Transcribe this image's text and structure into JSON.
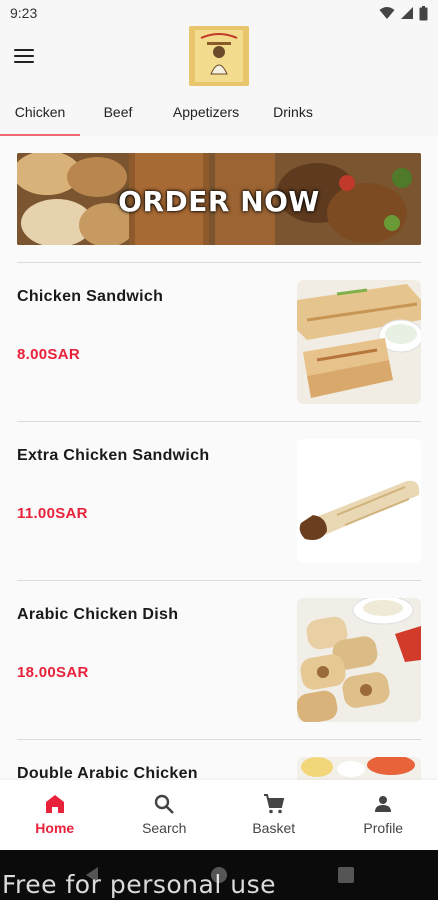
{
  "status_bar": {
    "time": "9:23"
  },
  "tabs": [
    {
      "label": "Chicken",
      "active": true
    },
    {
      "label": "Beef",
      "active": false
    },
    {
      "label": "Appetizers",
      "active": false
    },
    {
      "label": "Drinks",
      "active": false
    }
  ],
  "banner": {
    "text": "ORDER NOW"
  },
  "items": [
    {
      "name": "Chicken Sandwich",
      "price": "8.00SAR"
    },
    {
      "name": "Extra Chicken Sandwich",
      "price": "11.00SAR"
    },
    {
      "name": "Arabic  Chicken Dish",
      "price": "18.00SAR"
    },
    {
      "name": "Double Arabic Chicken",
      "price": ""
    }
  ],
  "bottom_nav": [
    {
      "label": "Home",
      "icon": "home-icon",
      "active": true
    },
    {
      "label": "Search",
      "icon": "search-icon",
      "active": false
    },
    {
      "label": "Basket",
      "icon": "cart-icon",
      "active": false
    },
    {
      "label": "Profile",
      "icon": "person-icon",
      "active": false
    }
  ],
  "watermark": "Free for personal use",
  "colors": {
    "accent": "#e8223a",
    "tab_indicator": "#f06a75",
    "background": "#fafafa"
  }
}
